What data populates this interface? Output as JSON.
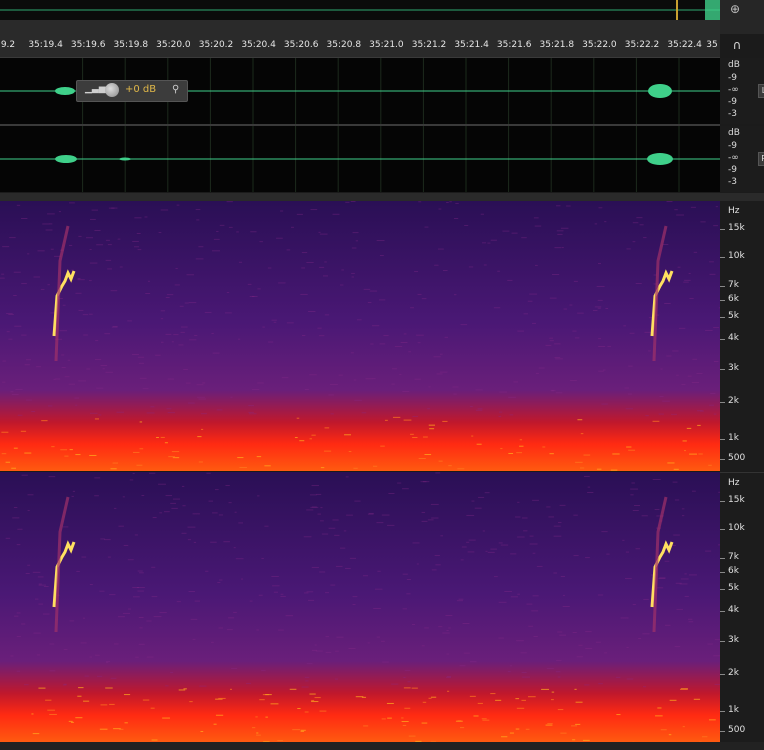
{
  "ruler": {
    "ticks": [
      "9.2",
      "35:19.4",
      "35:19.6",
      "35:19.8",
      "35:20.0",
      "35:20.2",
      "35:20.4",
      "35:20.6",
      "35:20.8",
      "35:21.0",
      "35:21.2",
      "35:21.4",
      "35:21.6",
      "35:21.8",
      "35:22.0",
      "35:22.2",
      "35:22.4",
      "35"
    ]
  },
  "waveform": {
    "db_labels": [
      "dB",
      "-9",
      "-∞",
      "-9",
      "-3"
    ],
    "left_channel": "L",
    "right_channel": "R"
  },
  "clip_hud": {
    "gain": "+0 dB"
  },
  "spectral": {
    "hz_labels": [
      "Hz",
      "15k",
      "10k",
      "7k",
      "6k",
      "5k",
      "4k",
      "3k",
      "2k",
      "1k",
      "500"
    ]
  },
  "icons": [
    "zoom-icon",
    "headphones-icon",
    "meter-icon",
    "knob-icon",
    "pin-icon"
  ],
  "colors": {
    "waveform": "#3fd08a",
    "gain_text": "#e0b84a"
  }
}
